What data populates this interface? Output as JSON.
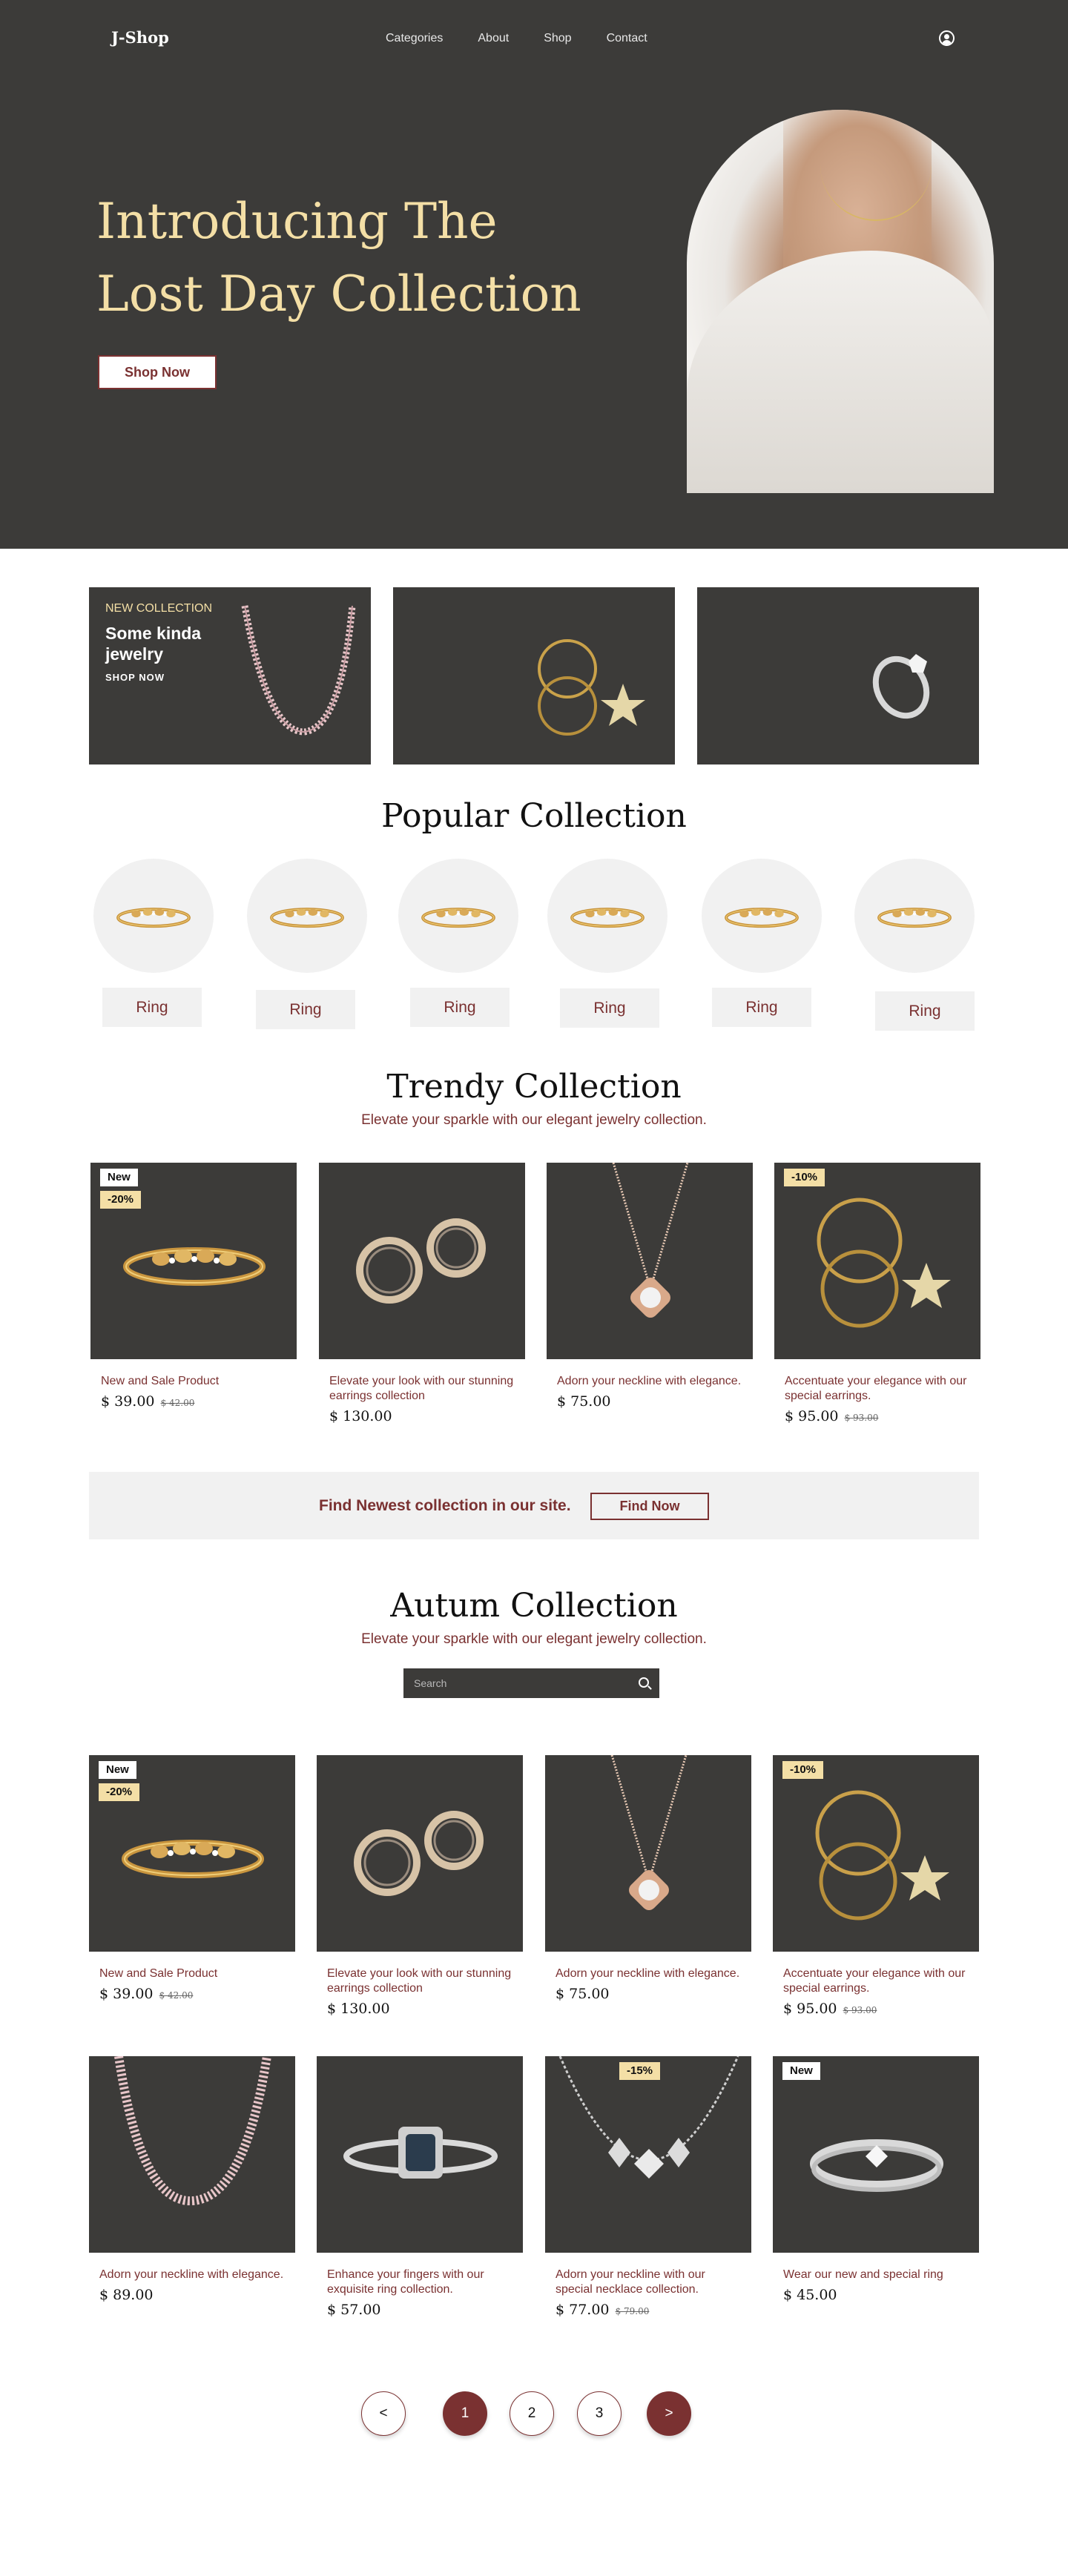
{
  "nav": {
    "logo": "J-Shop",
    "links": [
      "Categories",
      "About",
      "Shop",
      "Contact"
    ],
    "user_icon": "user-icon"
  },
  "hero": {
    "title_line1": "Introducing The",
    "title_line2": "Lost Day Collection",
    "cta": "Shop Now"
  },
  "features": {
    "tag": "NEW COLLECTION",
    "title": "Some kinda jewelry",
    "shop": "SHOP NOW"
  },
  "popular": {
    "title": "Popular Collection",
    "items": [
      "Ring",
      "Ring",
      "Ring",
      "Ring",
      "Ring",
      "Ring"
    ]
  },
  "trendy": {
    "title": "Trendy Collection",
    "subtitle": "Elevate your sparkle with our elegant jewelry collection.",
    "products": [
      {
        "desc": "New and Sale Product",
        "price": "$ 39.00",
        "old_price": "$ 42.00",
        "badge_new": "New",
        "badge_sale": "-20%"
      },
      {
        "desc": "Elevate your look with our stunning earrings collection",
        "price": "$ 130.00"
      },
      {
        "desc": "Adorn your neckline with elegance.",
        "price": "$ 75.00"
      },
      {
        "desc": "Accentuate your elegance with our special earrings.",
        "price": "$ 95.00",
        "old_price": "$ 93.00",
        "badge_sale": "-10%"
      }
    ]
  },
  "banner": {
    "text": "Find Newest collection in our site.",
    "cta": "Find Now"
  },
  "autumn": {
    "title": "Autum Collection",
    "subtitle": "Elevate your sparkle with our elegant jewelry collection.",
    "search_placeholder": "Search",
    "products": [
      {
        "desc": "New and Sale Product",
        "price": "$ 39.00",
        "old_price": "$ 42.00",
        "badge_new": "New",
        "badge_sale": "-20%"
      },
      {
        "desc": "Elevate your look with our stunning earrings collection",
        "price": "$ 130.00"
      },
      {
        "desc": "Adorn your neckline with elegance.",
        "price": "$ 75.00"
      },
      {
        "desc": "Accentuate your elegance with our special earrings.",
        "price": "$ 95.00",
        "old_price": "$ 93.00",
        "badge_sale": "-10%"
      },
      {
        "desc": "Adorn your neckline with elegance.",
        "price": "$ 89.00"
      },
      {
        "desc": "Enhance your fingers with our exquisite ring collection.",
        "price": "$ 57.00"
      },
      {
        "desc": "Adorn your neckline with our special necklace collection.",
        "price": "$ 77.00",
        "old_price": "$ 79.00",
        "badge_sale": "-15%"
      },
      {
        "desc": "Wear our new and special ring",
        "price": "$ 45.00",
        "badge_new": "New"
      }
    ]
  },
  "pagination": {
    "prev": "<",
    "pages": [
      "1",
      "2",
      "3"
    ],
    "next": ">"
  },
  "colors": {
    "dark": "#3c3b39",
    "accent": "#7a3131",
    "gold": "#f4dfa6",
    "light": "#f1f1f1"
  }
}
